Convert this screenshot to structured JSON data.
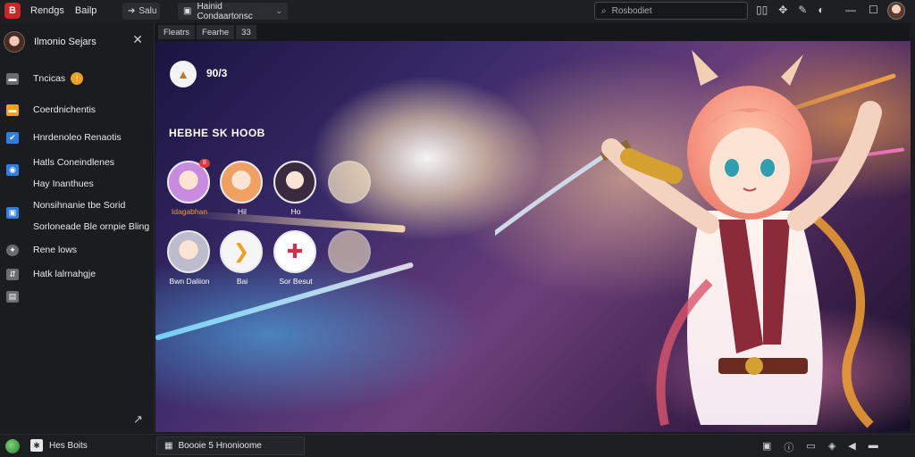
{
  "titlebar": {
    "app_logo": "B",
    "menu": [
      "Rendgs",
      "Bailp"
    ],
    "nav_label": "Salu",
    "location_label": "Hainid Condaartonsc",
    "search_placeholder": "Rosbodiet",
    "icons": [
      "bookmark-icon",
      "gamepad-icon",
      "pin-icon",
      "globe-icon"
    ],
    "window_controls": [
      "minimize-icon",
      "maximize-icon",
      "close-icon"
    ]
  },
  "sidebar": {
    "profile_name": "Ilmonio Sejars",
    "items": [
      {
        "icon": "folder-icon",
        "color": "#6b6b70",
        "label": "Tncicas",
        "badge": "!"
      },
      {
        "icon": "store-icon",
        "color": "#f0a020",
        "label": "Coerdnichentis",
        "badge": ""
      },
      {
        "icon": "library-icon",
        "color": "#2f7fe0",
        "label": "Hnrdenoleo Renaotis",
        "badge": ""
      },
      {
        "icon": "news-icon",
        "color": "#2f7fe0",
        "label": "Hatls Coneindlenes",
        "badge": ""
      },
      {
        "icon": "",
        "color": "",
        "label": "Hay Inanthues",
        "badge": ""
      },
      {
        "icon": "friends-icon",
        "color": "#2f7fe0",
        "label": "Nonsihnanie tbe Sorid",
        "badge": ""
      },
      {
        "icon": "",
        "color": "",
        "label": "Sorloneade Ble ornpie Bling",
        "badge": ""
      },
      {
        "icon": "settings-icon",
        "color": "#6b6b70",
        "label": "Rene lows",
        "badge": ""
      },
      {
        "icon": "download-icon",
        "color": "#6b6b70",
        "label": "Hatk lalrnahgje",
        "badge": ""
      },
      {
        "icon": "file-icon",
        "color": "#6b6b70",
        "label": "",
        "badge": ""
      }
    ]
  },
  "main": {
    "tabs": [
      "Fleatrs",
      "Fearhe",
      "33"
    ],
    "overlay": {
      "count": "90/3",
      "title": "HEBHE SK HOOB",
      "friends": [
        {
          "name": "Idagabhan",
          "badge": "8",
          "hue": "#c98be0"
        },
        {
          "name": "Hil",
          "badge": "",
          "hue": "#f0a060"
        },
        {
          "name": "Ho",
          "badge": "",
          "hue": "#6a4a7a"
        },
        {
          "name": "",
          "badge": "",
          "hue": "#f2e2c0"
        },
        {
          "name": "Bwn Daliion",
          "badge": "",
          "hue": "#bcbccc"
        },
        {
          "name": "Bai",
          "badge": "",
          "hue": "#f5f5f5"
        },
        {
          "name": "Sor Besut",
          "badge": "",
          "hue": "#ffffff"
        },
        {
          "name": "",
          "badge": "",
          "hue": "#f2e2c0"
        }
      ]
    }
  },
  "bottombar": {
    "left_label": "Hes Boits",
    "panel_label": "Boooie 5 Hnonioome",
    "right_icons": [
      "image-icon",
      "info-icon",
      "monitor-icon",
      "volume-icon",
      "speaker-icon",
      "keyboard-icon"
    ]
  },
  "colors": {
    "accent": "#f0a020",
    "blue": "#2f7fe0",
    "notification": "#e23636"
  }
}
